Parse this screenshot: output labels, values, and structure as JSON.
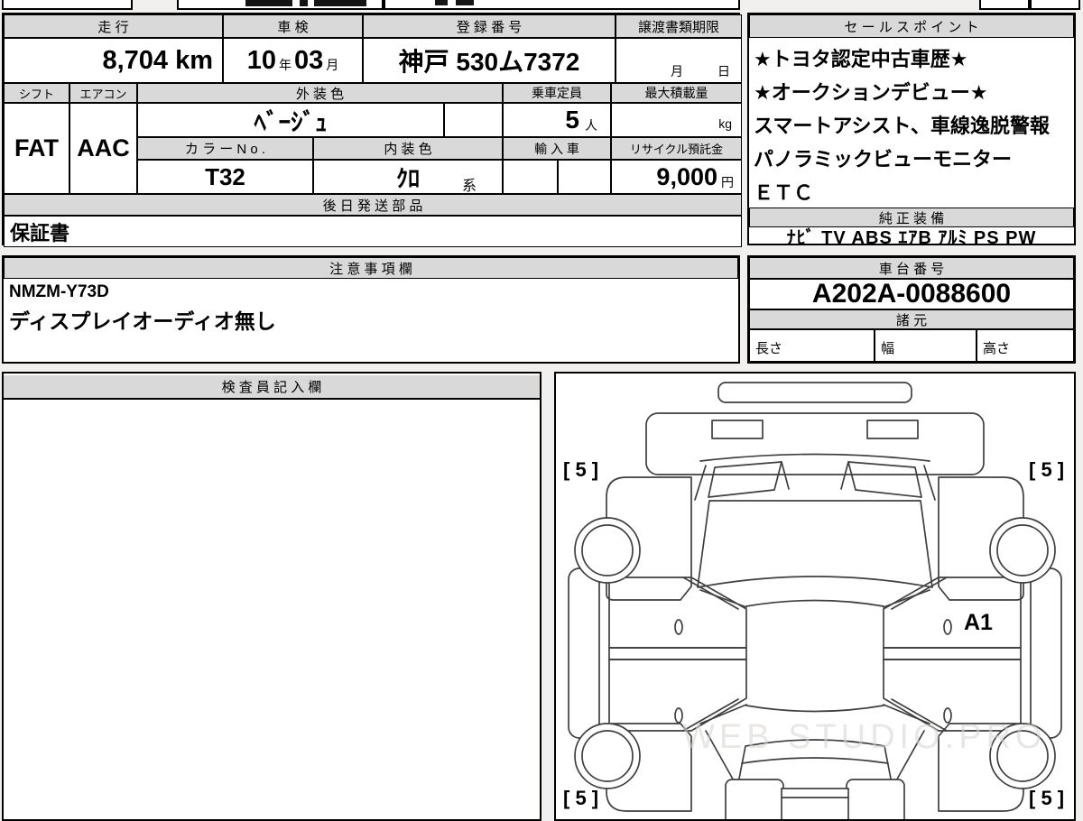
{
  "colors": {
    "page_bg": "#f1f0ee",
    "header_bg": "#d9d9d9",
    "border": "#000000",
    "diagram_line": "#3f3f3f",
    "watermark": "#d6d4d0"
  },
  "main_table": {
    "headers": {
      "mileage": "走 行",
      "shaken": "車 検",
      "registration": "登 録 番 号",
      "transfer_deadline": "譲渡書類期限",
      "shift": "シフト",
      "aircon": "エアコン",
      "exterior_color": "外 装 色",
      "capacity": "乗車定員",
      "max_load": "最大積載量",
      "color_no": "カ ラ ー N o .",
      "interior_color": "内 装 色",
      "import_car": "輸 入 車",
      "recycle_deposit": "リサイクル預託金",
      "later_parts": "後 日 発 送 部 品"
    },
    "values": {
      "mileage": "8,704 km",
      "shaken_year": "10",
      "shaken_year_unit": "年",
      "shaken_month": "03",
      "shaken_month_unit": "月",
      "registration": "神戸 530ム7372",
      "deadline_month": "月",
      "deadline_day": "日",
      "shift": "FAT",
      "aircon": "AAC",
      "exterior_color": "ﾍﾞｰｼﾞｭ",
      "capacity": "5",
      "capacity_unit": "人",
      "max_load_unit": "kg",
      "color_no": "T32",
      "interior_color": "ｸﾛ",
      "interior_color_suffix": "系",
      "recycle_amount": "9,000",
      "recycle_unit": "円",
      "later_parts": "保証書"
    }
  },
  "sales": {
    "header": "セ ー ル ス ポ イ ン ト",
    "lines": [
      "★トヨタ認定中古車歴★",
      "★オークションデビュー★",
      "スマートアシスト、車線逸脱警報",
      "パノラミックビューモニター",
      "ＥＴＣ"
    ],
    "oem_header": "純 正 装 備",
    "oem_items": "ﾅﾋﾞ TV ABS ｴｱB ｱﾙﾐ PS PW"
  },
  "notes": {
    "header": "注 意 事 項 欄",
    "lines": [
      "NMZM-Y73D",
      "ディスプレイオーディオ無し"
    ]
  },
  "chassis": {
    "header": "車 台 番 号",
    "number": "A202A-0088600",
    "spec_header": "諸 元",
    "length_label": "長さ",
    "width_label": "幅",
    "height_label": "高さ"
  },
  "inspector": {
    "header": "検 査 員 記 入 欄"
  },
  "diagram": {
    "corner_mark_tl": "[ 5 ]",
    "corner_mark_tr": "[ 5 ]",
    "corner_mark_bl": "[ 5 ]",
    "corner_mark_br": "[ 5 ]",
    "damage_mark": "A1",
    "watermark": "WEB STUDIO.PRO"
  }
}
